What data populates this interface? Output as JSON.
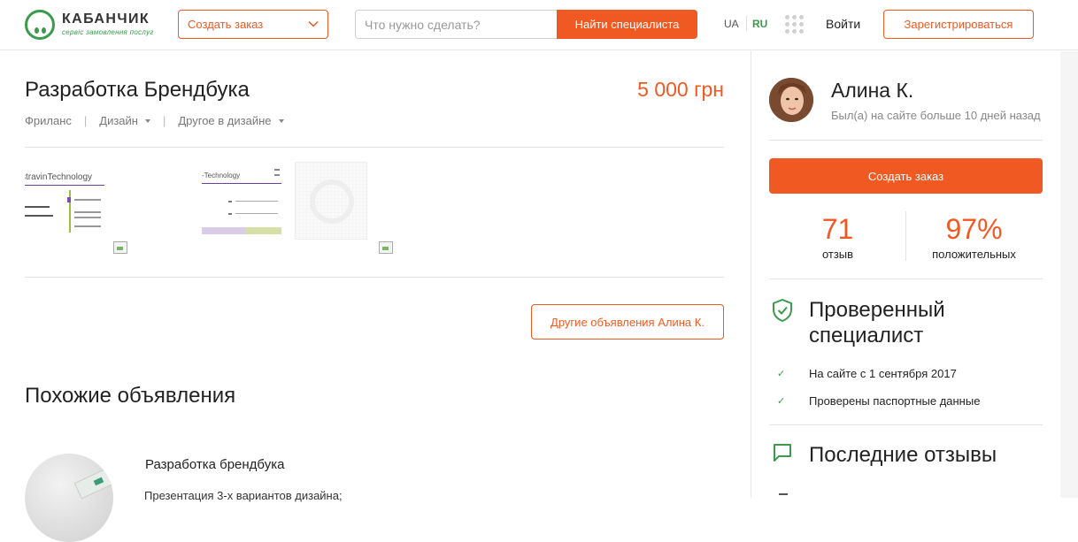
{
  "header": {
    "logo": {
      "name": "КАБАНЧИК",
      "tagline": "сервіс замовлення послуг"
    },
    "order_select_label": "Создать заказ",
    "search": {
      "placeholder": "Что нужно сделать?",
      "button_label": "Найти специалиста"
    },
    "languages": [
      {
        "code": "UA",
        "active": false
      },
      {
        "code": "RU",
        "active": true
      }
    ],
    "login_label": "Войти",
    "register_label": "Зарегистрироваться"
  },
  "listing": {
    "title": "Разработка Брендбука",
    "price": "5 000 грн",
    "breadcrumbs": [
      {
        "label": "Фриланс",
        "dropdown": false
      },
      {
        "label": "Дизайн",
        "dropdown": true
      },
      {
        "label": "Другое в дизайне",
        "dropdown": true
      }
    ],
    "thumbnails": [
      {
        "caption": "stravinTechnology"
      },
      {
        "caption": "-Technology"
      },
      {
        "caption": ""
      }
    ],
    "other_ads_button": "Другие объявления Алина К."
  },
  "similar": {
    "title": "Похожие объявления",
    "items": [
      {
        "title": "Разработка брендбука",
        "description": "Презентация 3-х вариантов дизайна;"
      }
    ]
  },
  "profile": {
    "name": "Алина К.",
    "last_seen": "Был(а) на сайте больше 10 дней назад",
    "create_order_label": "Создать заказ",
    "stats": [
      {
        "value": "71",
        "label": "отзыв"
      },
      {
        "value": "97%",
        "label": "положительных"
      }
    ],
    "verified": {
      "title": "Проверенный специалист",
      "items": [
        "На сайте с 1 сентября 2017",
        "Проверены паспортные данные"
      ]
    },
    "reviews_title": "Последние отзывы"
  },
  "colors": {
    "accent": "#f05a22",
    "brand_green": "#3a9b4d"
  },
  "icons": [
    "chevron-down-icon",
    "apps-grid-icon",
    "shield-check-icon",
    "chat-bubble-icon",
    "check-icon"
  ]
}
